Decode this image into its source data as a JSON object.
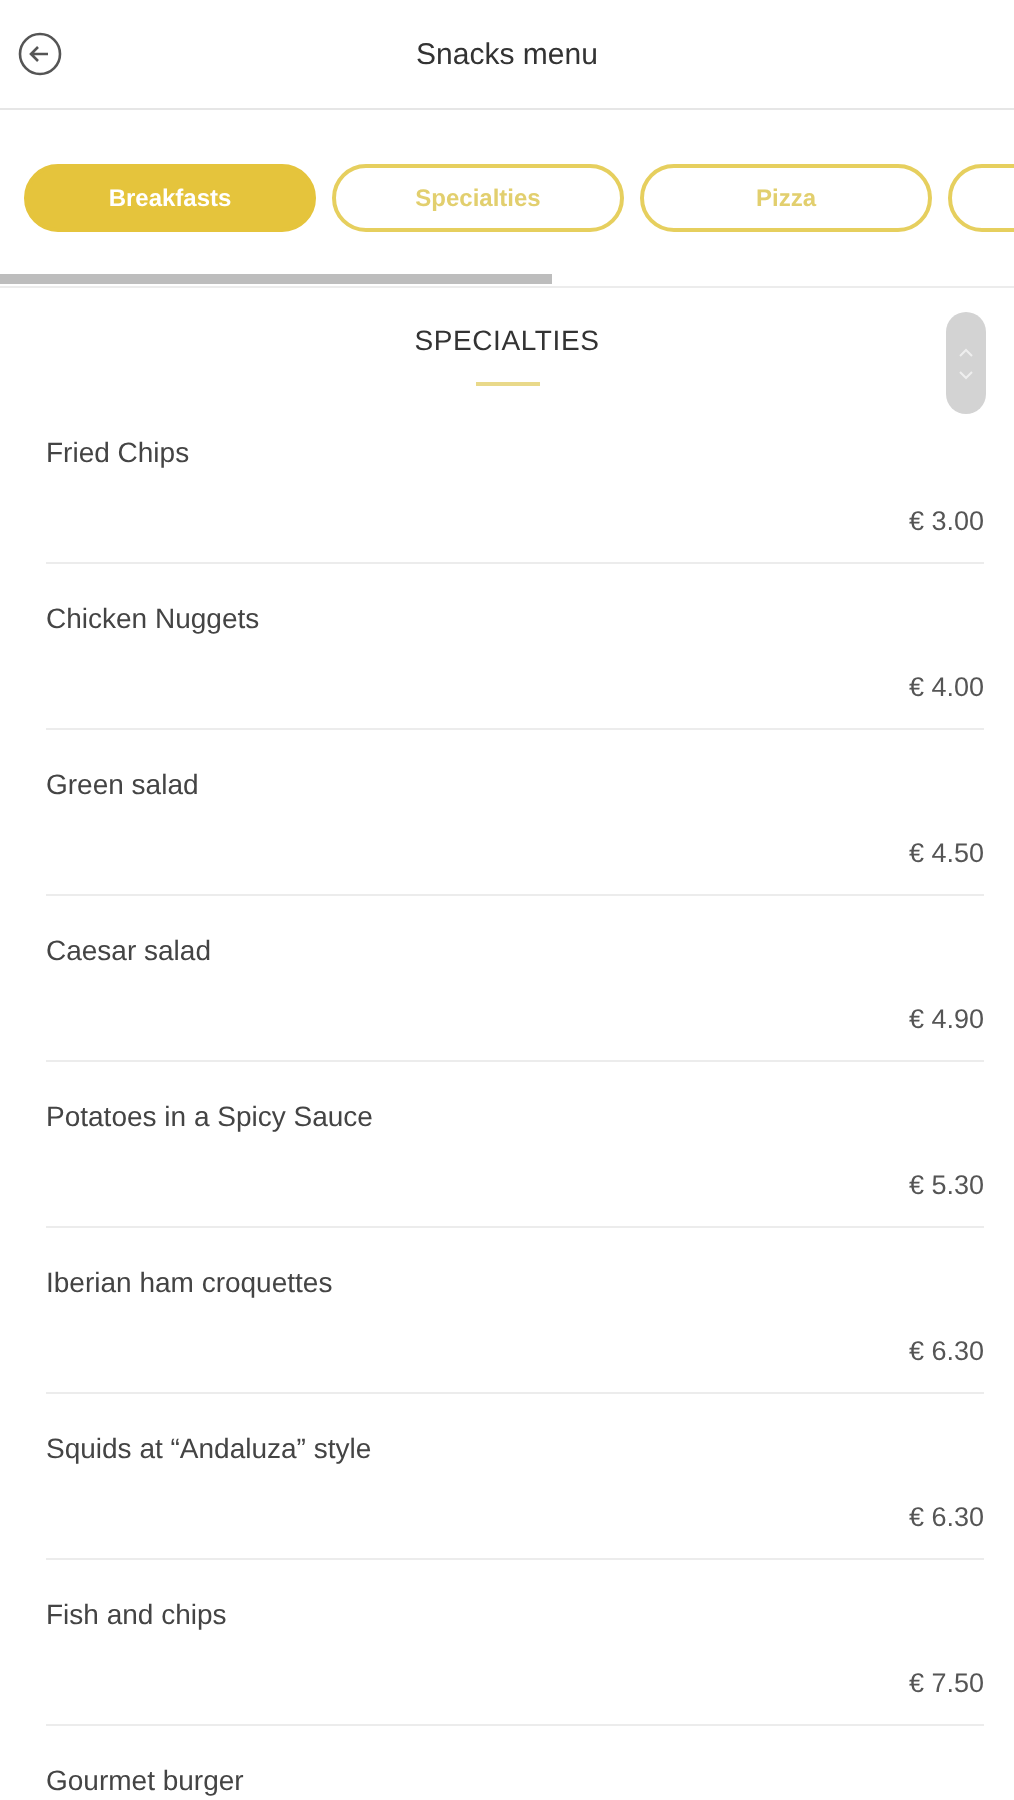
{
  "header": {
    "title": "Snacks menu"
  },
  "tabs": [
    {
      "label": "Breakfasts",
      "selected": true
    },
    {
      "label": "Specialties",
      "selected": false
    },
    {
      "label": "Pizza",
      "selected": false
    },
    {
      "selected": false
    }
  ],
  "section": {
    "title": "SPECIALTIES"
  },
  "items": [
    {
      "name": "Fried Chips",
      "price": "€ 3.00"
    },
    {
      "name": "Chicken Nuggets",
      "price": "€ 4.00"
    },
    {
      "name": "Green salad",
      "price": "€ 4.50"
    },
    {
      "name": "Caesar salad",
      "price": "€ 4.90"
    },
    {
      "name": "Potatoes in a Spicy Sauce",
      "price": "€ 5.30"
    },
    {
      "name": "Iberian ham croquettes",
      "price": "€ 6.30"
    },
    {
      "name": "Squids at “Andaluza” style",
      "price": "€ 6.30"
    },
    {
      "name": "Fish and chips",
      "price": "€ 7.50"
    },
    {
      "name": "Gourmet burger"
    }
  ]
}
